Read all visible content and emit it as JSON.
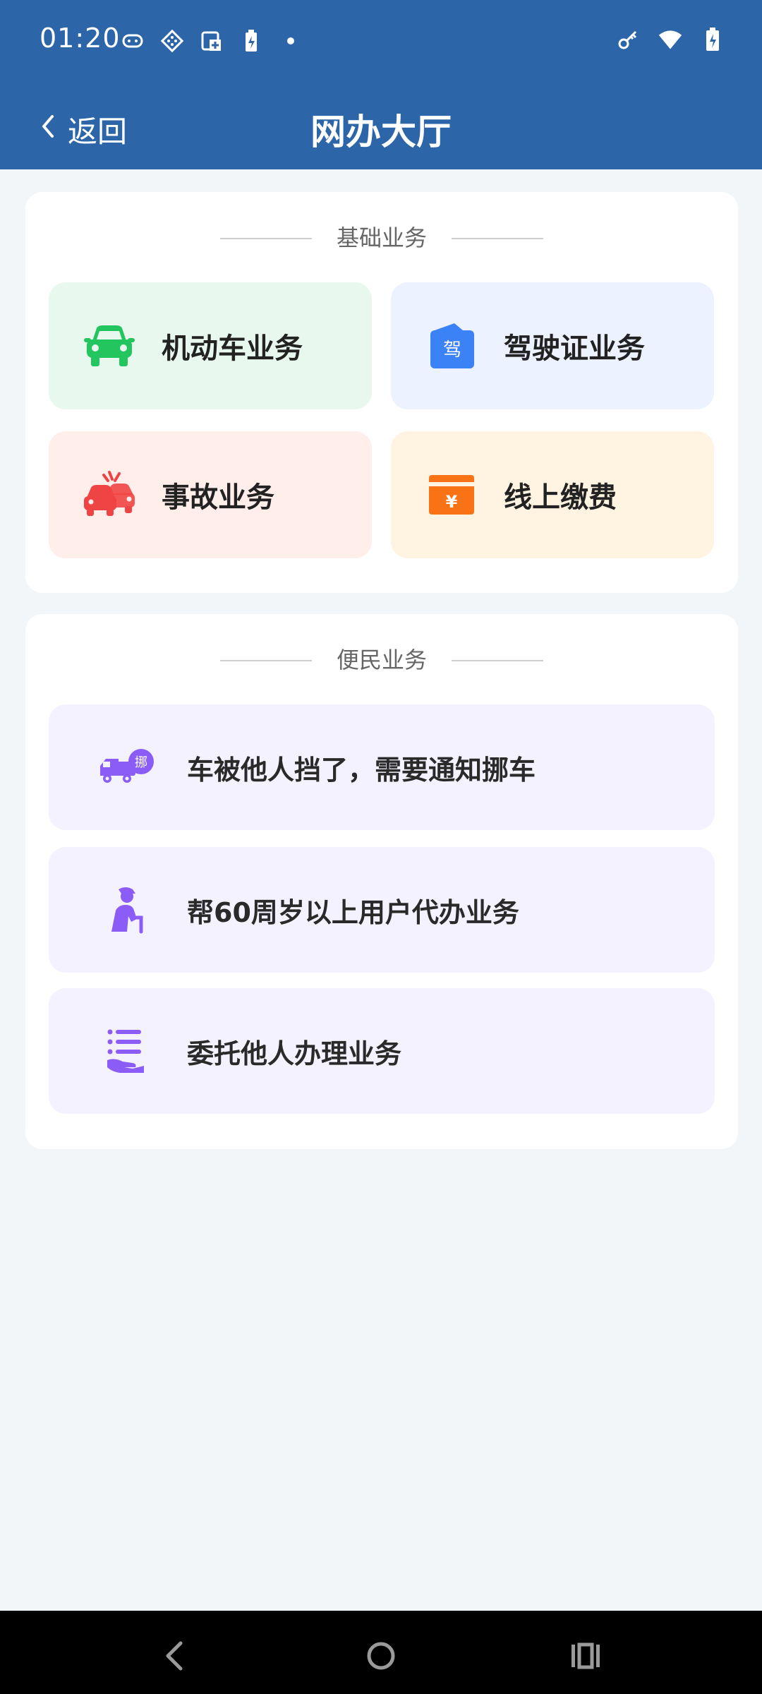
{
  "status_bar": {
    "time": "01:20",
    "left_icons": [
      "gamepad-icon",
      "diamond-grid-icon",
      "screenshot-icon",
      "battery-charging-icon",
      "dot-icon"
    ],
    "right_icons": [
      "key-icon",
      "wifi-icon",
      "battery-icon"
    ]
  },
  "header": {
    "back_label": "返回",
    "title": "网办大厅"
  },
  "basic_section": {
    "title": "基础业务",
    "tiles": [
      {
        "label": "机动车业务",
        "icon": "car-icon",
        "color": "#22c55e"
      },
      {
        "label": "驾驶证业务",
        "icon": "license-icon",
        "color": "#3b82f6"
      },
      {
        "label": "事故业务",
        "icon": "accident-icon",
        "color": "#ef4444"
      },
      {
        "label": "线上缴费",
        "icon": "payment-icon",
        "color": "#f97316"
      }
    ]
  },
  "convenience_section": {
    "title": "便民业务",
    "items": [
      {
        "label": "车被他人挡了，需要通知挪车",
        "icon": "move-car-truck-icon"
      },
      {
        "label": "帮60周岁以上用户代办业务",
        "icon": "elderly-person-icon"
      },
      {
        "label": "委托他人办理业务",
        "icon": "delegate-hand-list-icon"
      }
    ],
    "accent": "#8b5cf6"
  },
  "nav_bar": {
    "icons": [
      "back-icon",
      "home-icon",
      "recents-icon"
    ]
  }
}
